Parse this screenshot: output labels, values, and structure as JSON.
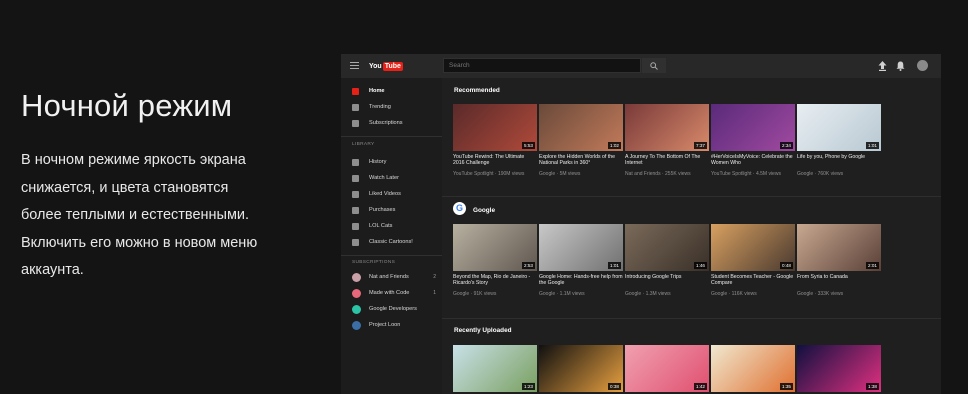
{
  "promo": {
    "title": "Ночной режим",
    "lines": [
      "В ночном режиме яркость экрана",
      "снижается, и цвета становятся",
      "более теплыми и естественными.",
      "Включить его можно в новом меню",
      "аккаунта."
    ]
  },
  "youtube": {
    "logo_you": "You",
    "logo_tube": "Tube",
    "search_placeholder": "Search",
    "sidebar": {
      "main": [
        {
          "label": "Home",
          "active": true,
          "icon": "home-icon"
        },
        {
          "label": "Trending",
          "icon": "flame-icon"
        },
        {
          "label": "Subscriptions",
          "icon": "subscriptions-icon"
        }
      ],
      "library_header": "LIBRARY",
      "library": [
        {
          "label": "History",
          "icon": "history-icon"
        },
        {
          "label": "Watch Later",
          "icon": "clock-icon"
        },
        {
          "label": "Liked Videos",
          "icon": "thumbs-up-icon"
        },
        {
          "label": "Purchases",
          "icon": "tag-icon"
        },
        {
          "label": "LOL Cats",
          "icon": "playlist-icon"
        },
        {
          "label": "Classic Cartoons!",
          "icon": "playlist-icon"
        }
      ],
      "subscriptions_header": "SUBSCRIPTIONS",
      "subscriptions": [
        {
          "label": "Nat and Friends",
          "count": "2",
          "color": "#c9a0a8"
        },
        {
          "label": "Made with Code",
          "count": "1",
          "color": "#e8677a"
        },
        {
          "label": "Google Developers",
          "count": "",
          "color": "#2bc4a7"
        },
        {
          "label": "Project Loon",
          "count": "",
          "color": "#3a6ea5"
        }
      ]
    },
    "sections": {
      "recommended": {
        "title": "Recommended",
        "videos": [
          {
            "title": "YouTube Rewind: The Ultimate 2016 Challenge",
            "meta": "YouTube Spotlight · 190M views",
            "duration": "5:53",
            "colors": [
              "#5a2a2a",
              "#b04a3a"
            ]
          },
          {
            "title": "Explore the Hidden Worlds of the National Parks in 360°",
            "meta": "Google · 5M views",
            "duration": "1:02",
            "colors": [
              "#6a4a3a",
              "#c27a5a"
            ]
          },
          {
            "title": "A Journey To The Bottom Of The Internet",
            "meta": "Nat and Friends · 255K views",
            "duration": "7:37",
            "colors": [
              "#7a3a3a",
              "#d88a6a"
            ]
          },
          {
            "title": "#HerVoiceIsMyVoice: Celebrate the Women Who",
            "meta": "YouTube Spotlight · 4.5M views",
            "duration": "2:34",
            "colors": [
              "#5a2a7a",
              "#a04aa0"
            ]
          },
          {
            "title": "Life by you, Phone by Google",
            "meta": "Google · 760K views",
            "duration": "1:01",
            "colors": [
              "#e8eef2",
              "#b8c8d2"
            ]
          }
        ]
      },
      "google": {
        "title": "Google",
        "videos": [
          {
            "title": "Beyond the Map, Rio de Janeiro - Ricardo's Story",
            "meta": "Google · 91K views",
            "duration": "2:53",
            "colors": [
              "#b8b0a0",
              "#605850"
            ]
          },
          {
            "title": "Google Home: Hands-free help from the Google",
            "meta": "Google · 1.1M views",
            "duration": "1:01",
            "colors": [
              "#c8c8c8",
              "#707070"
            ]
          },
          {
            "title": "Introducing Google Trips",
            "meta": "Google · 1.3M views",
            "duration": "1:46",
            "colors": [
              "#7a6a5a",
              "#3a3028"
            ]
          },
          {
            "title": "Student Becomes Teacher - Google Compare",
            "meta": "Google · 116K views",
            "duration": "0:48",
            "colors": [
              "#d8a060",
              "#4a3a30"
            ]
          },
          {
            "title": "From Syria to Canada",
            "meta": "Google · 333K views",
            "duration": "2:01",
            "colors": [
              "#c8a890",
              "#5a4038"
            ]
          }
        ]
      },
      "recently_uploaded": {
        "title": "Recently Uploaded",
        "videos": [
          {
            "duration": "1:23",
            "colors": [
              "#c8e0e8",
              "#7aa060"
            ]
          },
          {
            "duration": "0:38",
            "colors": [
              "#101010",
              "#e8a040"
            ]
          },
          {
            "duration": "1:42",
            "colors": [
              "#f0a0b0",
              "#e05070"
            ]
          },
          {
            "duration": "1:35",
            "colors": [
              "#f0e8d0",
              "#e07030"
            ]
          },
          {
            "duration": "1:38",
            "colors": [
              "#101040",
              "#e03080"
            ]
          }
        ]
      }
    }
  }
}
